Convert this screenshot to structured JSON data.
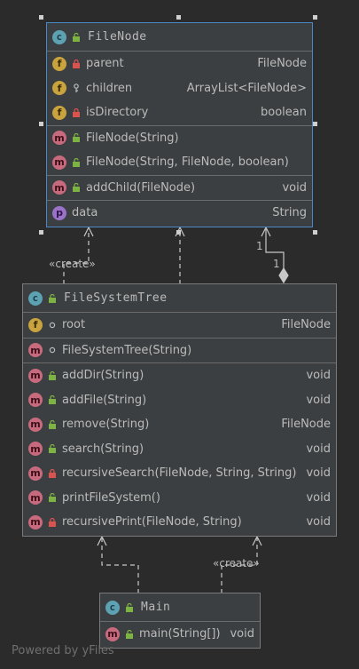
{
  "classes": {
    "filenode": {
      "name": "FileNode",
      "fields": [
        {
          "name": "parent",
          "type": "FileNode",
          "visibility": "private"
        },
        {
          "name": "children",
          "type": "ArrayList<FileNode>",
          "visibility": "package"
        },
        {
          "name": "isDirectory",
          "type": "boolean",
          "visibility": "private"
        }
      ],
      "constructors": [
        {
          "name": "FileNode(String)",
          "type": "",
          "visibility": "public"
        },
        {
          "name": "FileNode(String, FileNode, boolean)",
          "type": "",
          "visibility": "public"
        }
      ],
      "methods": [
        {
          "name": "addChild(FileNode)",
          "type": "void",
          "visibility": "public"
        }
      ],
      "properties": [
        {
          "name": "data",
          "type": "String",
          "visibility": "public"
        }
      ]
    },
    "filesystemtree": {
      "name": "FileSystemTree",
      "fields": [
        {
          "name": "root",
          "type": "FileNode",
          "visibility": "package"
        }
      ],
      "constructors": [
        {
          "name": "FileSystemTree(String)",
          "type": "",
          "visibility": "package"
        }
      ],
      "methods": [
        {
          "name": "addDir(String)",
          "type": "void",
          "visibility": "public"
        },
        {
          "name": "addFile(String)",
          "type": "void",
          "visibility": "public"
        },
        {
          "name": "remove(String)",
          "type": "FileNode",
          "visibility": "public"
        },
        {
          "name": "search(String)",
          "type": "void",
          "visibility": "public"
        },
        {
          "name": "recursiveSearch(FileNode, String, String)",
          "type": "void",
          "visibility": "private"
        },
        {
          "name": "printFileSystem()",
          "type": "void",
          "visibility": "public"
        },
        {
          "name": "recursivePrint(FileNode, String)",
          "type": "void",
          "visibility": "private"
        }
      ]
    },
    "main": {
      "name": "Main",
      "methods": [
        {
          "name": "main(String[])",
          "type": "void",
          "visibility": "public"
        }
      ]
    }
  },
  "relations": {
    "create_label_top": "«create»",
    "create_label_bottom": "«create»",
    "multiplicity_a": "1",
    "multiplicity_b": "1"
  },
  "footer": "Powered by yFiles",
  "colors": {
    "background": "#2b2b2b",
    "class_fill": "#3c3f41",
    "selected_border": "#4a88c7",
    "field_icon": "#c8a33e",
    "method_icon": "#c86a7d",
    "class_icon": "#5da2b3",
    "property_icon": "#9a73c8"
  }
}
